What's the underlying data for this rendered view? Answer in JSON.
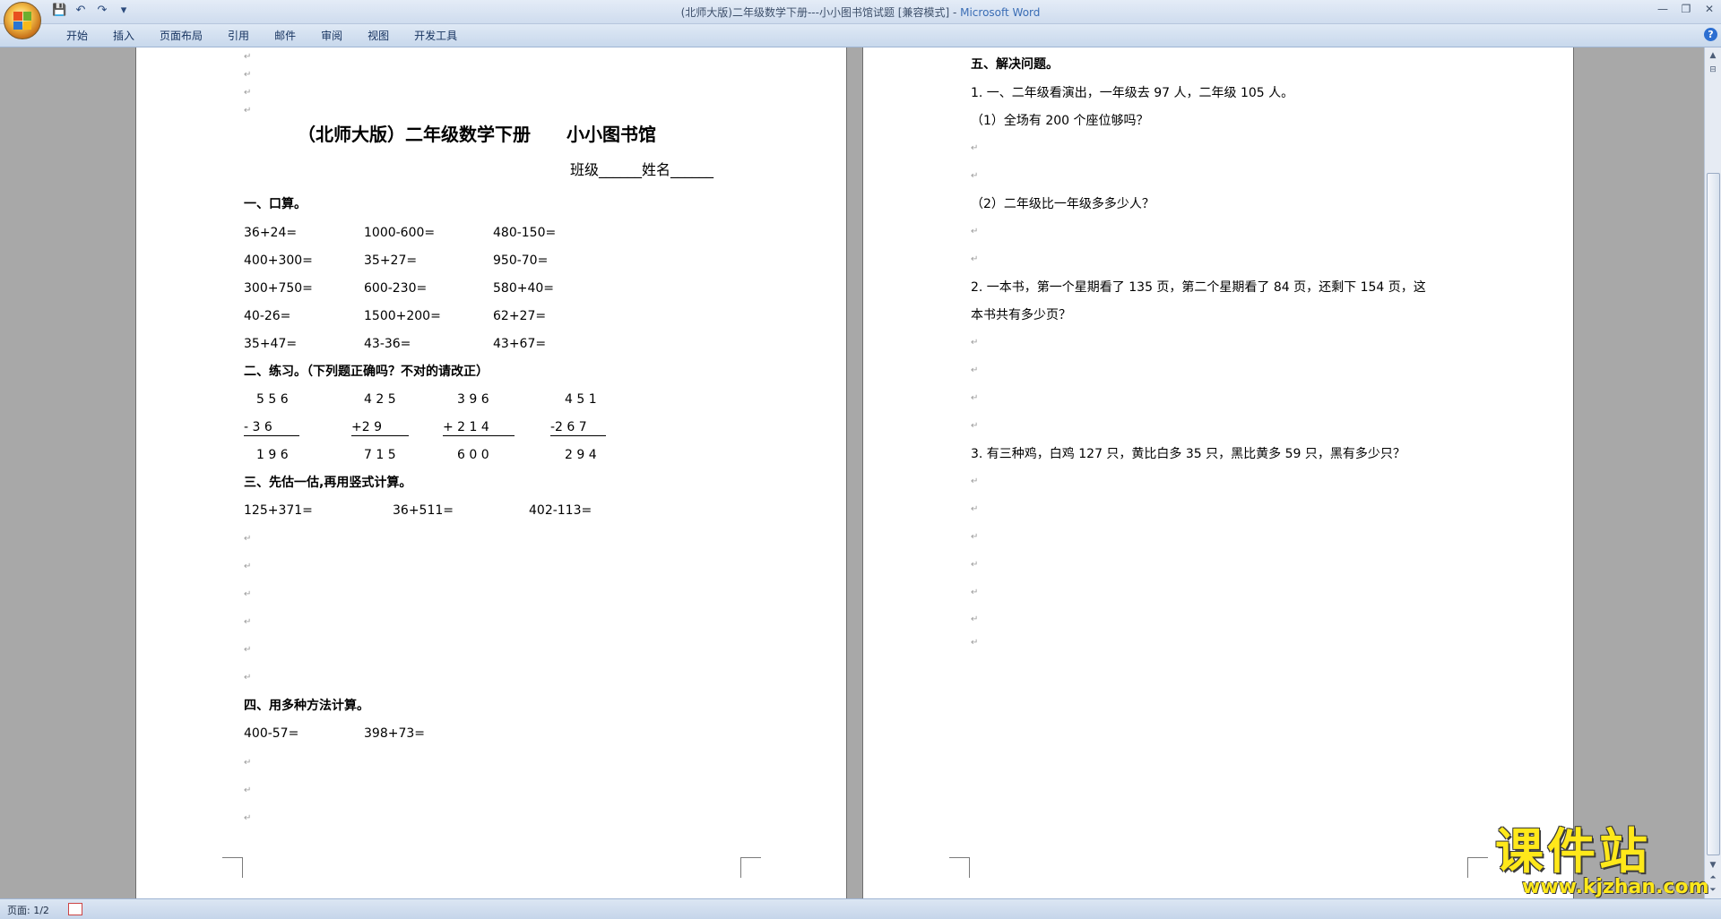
{
  "window": {
    "title_doc": "(北师大版)二年级数学下册---小小图书馆试题 [兼容模式]",
    "title_sep": " - ",
    "title_app": "Microsoft Word"
  },
  "quick_access": {
    "save": "💾",
    "undo": "↶",
    "redo": "↷",
    "more": "▾"
  },
  "window_controls": {
    "minimize": "—",
    "restore": "❐",
    "close": "✕"
  },
  "tabs": [
    "开始",
    "插入",
    "页面布局",
    "引用",
    "邮件",
    "审阅",
    "视图",
    "开发工具"
  ],
  "help": "?",
  "page1": {
    "title": "（北师大版）二年级数学下册　　小小图书馆",
    "classname": "班级______姓名______",
    "s1_heading": "一、口算。",
    "oral": [
      [
        "36+24=",
        "1000-600=",
        "480-150="
      ],
      [
        "400+300=",
        "35+27=",
        "950-70="
      ],
      [
        "300+750=",
        "600-230=",
        "580+40="
      ],
      [
        "40-26=",
        "1500+200=",
        "62+27="
      ],
      [
        "35+47=",
        "43-36=",
        "43+67="
      ]
    ],
    "s2_heading": "二、练习。（下列题正确吗？不对的请改正）",
    "vert_top": [
      "5 5 6",
      "4 2 5",
      "3 9 6",
      "4 5 1"
    ],
    "vert_mid": [
      "- 3 6",
      "+2 9",
      "+ 2 1 4",
      "-2 6 7"
    ],
    "vert_bot": [
      "1 9 6",
      "7 1 5",
      "6 0 0",
      "2 9 4"
    ],
    "s3_heading": "三、先估一估,再用竖式计算。",
    "estimate": [
      "125+371=",
      "36+511=",
      "402-113="
    ],
    "s4_heading": "四、用多种方法计算。",
    "methods": [
      "400-57=",
      "398+73="
    ]
  },
  "page2": {
    "s5_heading": "五、解决问题。",
    "q1": "1. 一、二年级看演出，一年级去 97 人，二年级 105 人。",
    "q1a": "（1）全场有 200 个座位够吗？",
    "q1b": "（2）二年级比一年级多多少人？",
    "q2_line1": "2. 一本书，第一个星期看了 135 页，第二个星期看了 84 页，还剩下 154 页，这",
    "q2_line2": "本书共有多少页？",
    "q3": "3. 有三种鸡，白鸡 127 只，黄比白多 35 只，黑比黄多 59 只，黑有多少只？"
  },
  "paragraph_mark": "↵",
  "status": {
    "page": "页面: 1/2"
  },
  "watermark": {
    "main": "课件站",
    "url": "www.kjzhan.com"
  }
}
